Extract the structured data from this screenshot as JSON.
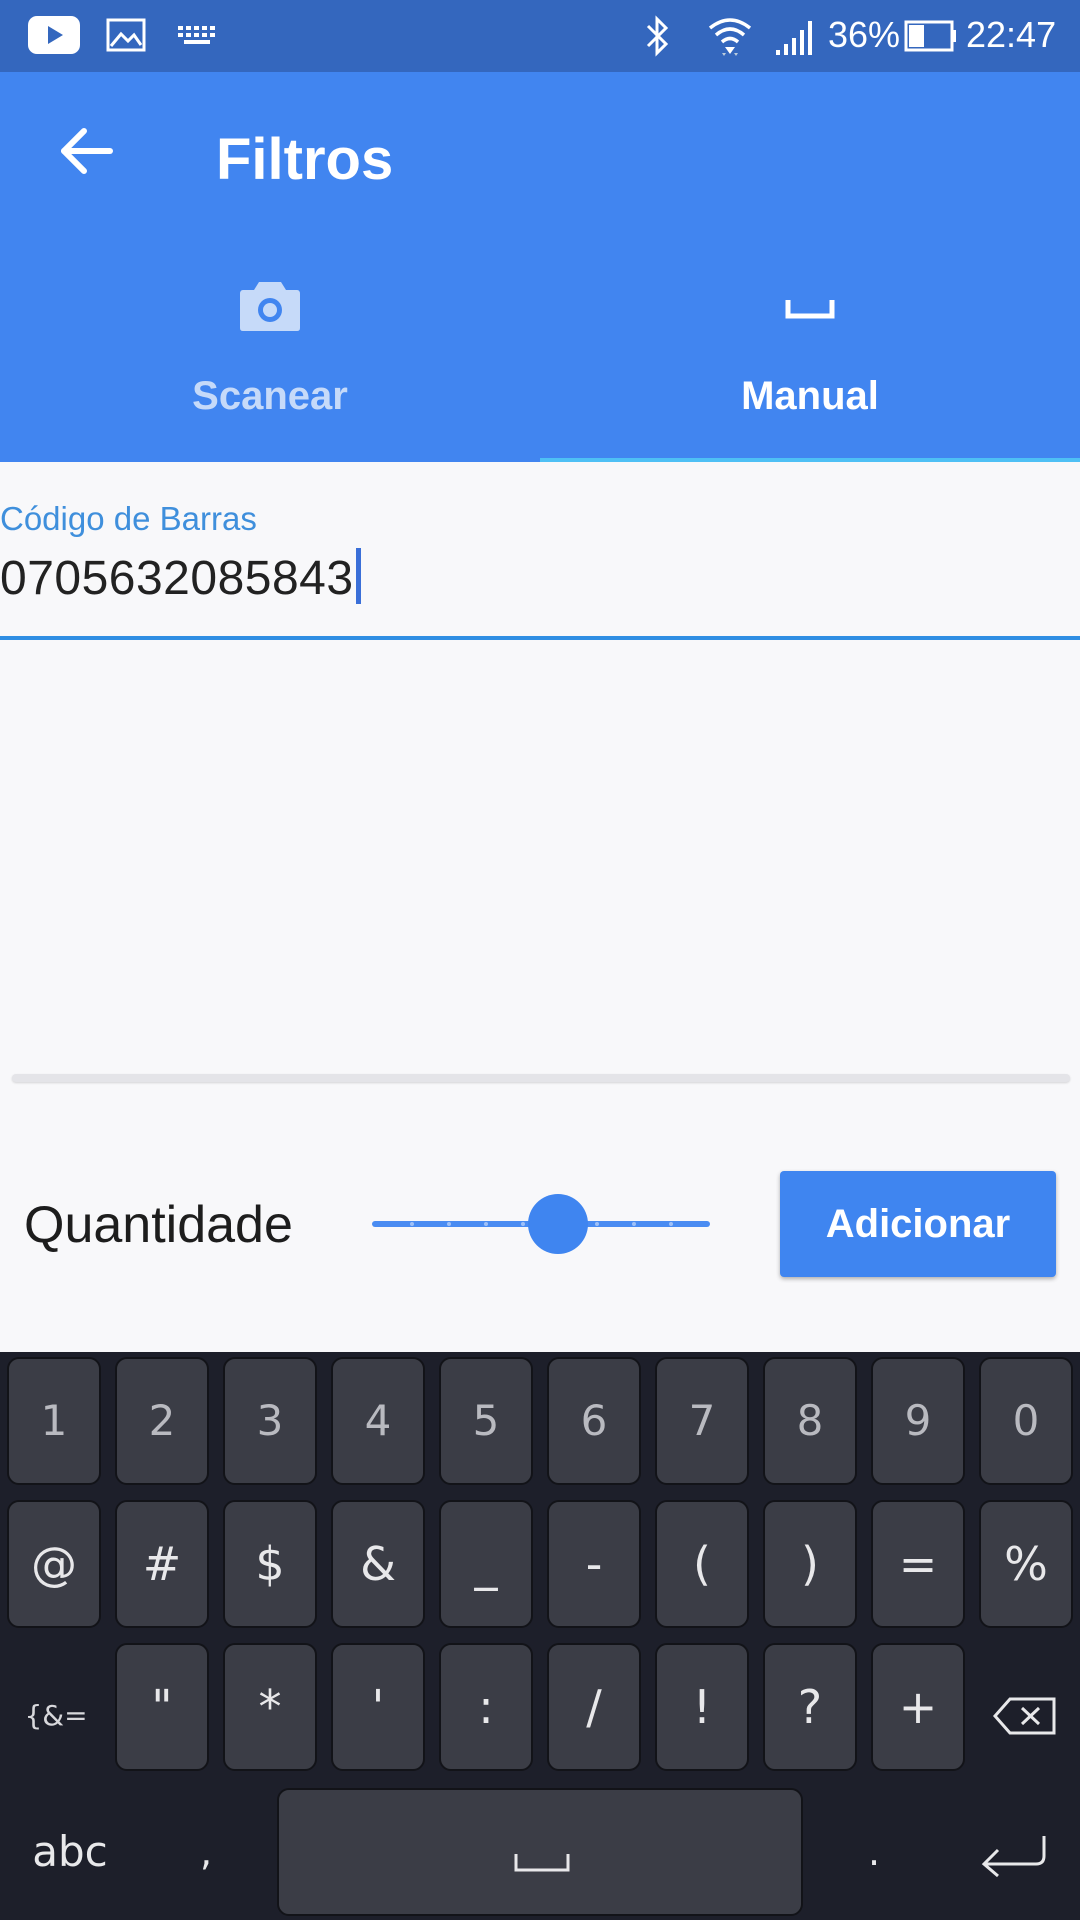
{
  "status_bar": {
    "battery_percent": "36%",
    "time": "22:47",
    "icons": [
      "youtube-icon",
      "image-icon",
      "keyboard-icon",
      "bluetooth-icon",
      "wifi-icon",
      "signal-icon",
      "battery-icon"
    ]
  },
  "app_bar": {
    "title": "Filtros",
    "back_icon": "arrow-left-icon",
    "tabs": [
      {
        "label": "Scanear",
        "icon": "camera-icon",
        "selected": false
      },
      {
        "label": "Manual",
        "icon": "space-bar-icon",
        "selected": true
      }
    ]
  },
  "barcode_field": {
    "label": "Código de Barras",
    "value": "0705632085843"
  },
  "quantity": {
    "label": "Quantidade",
    "slider_fraction": 0.55
  },
  "add_button": {
    "label": "Adicionar"
  },
  "keyboard": {
    "row1": [
      "1",
      "2",
      "3",
      "4",
      "5",
      "6",
      "7",
      "8",
      "9",
      "0"
    ],
    "row2": [
      "@",
      "#",
      "$",
      "&",
      "_",
      "-",
      "(",
      ")",
      "=",
      "%"
    ],
    "row3": [
      "\"",
      "*",
      "'",
      ":",
      "/",
      "!",
      "?",
      "+"
    ],
    "row3_left": "{&=",
    "row4_left": "abc",
    "row4_comma": ",",
    "row4_period": ".",
    "space_icon": "space-bar-icon",
    "backspace_icon": "backspace-icon",
    "enter_icon": "enter-icon"
  },
  "colors": {
    "app_bar": "#4185f0",
    "status_bar": "#3467be",
    "accent": "#2f8ee3",
    "keyboard_bg": "#1d1f2a",
    "key_bg": "#3b3d46"
  }
}
